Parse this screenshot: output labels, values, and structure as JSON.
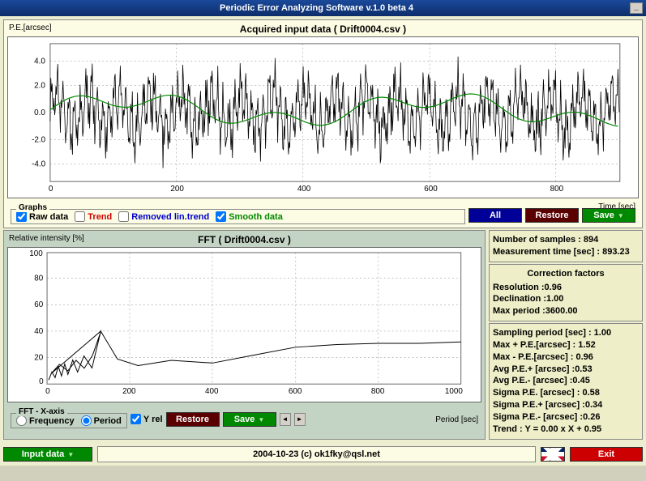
{
  "window": {
    "title": "Periodic Error Analyzing Software v.1.0 beta 4"
  },
  "top_chart": {
    "title": "Acquired input data ( Drift0004.csv )",
    "ylabel": "P.E.[arcsec]",
    "xlabel": "Time [sec]"
  },
  "graphs": {
    "title": "Graphs",
    "raw": "Raw data",
    "trend": "Trend",
    "removed": "Removed lin.trend",
    "smooth": "Smooth data",
    "all": "All",
    "restore": "Restore",
    "save": "Save"
  },
  "fft_chart": {
    "title": "FFT  ( Drift0004.csv )",
    "ylabel": "Relative intensity [%]",
    "xlabel": "Period [sec]"
  },
  "fft_axis": {
    "title": "FFT - X-axis",
    "freq": "Frequency",
    "period": "Period",
    "yrel": "Y rel",
    "restore": "Restore",
    "save": "Save"
  },
  "info1": {
    "samples": "Number of samples : 894",
    "mtime": "Measurement time [sec] : 893.23"
  },
  "info2": {
    "title": "Correction factors",
    "res": "Resolution :0.96",
    "dec": "Declination :1.00",
    "maxp": "Max period :3600.00"
  },
  "info3": {
    "l1": "Sampling period [sec] : 1.00",
    "l2": "Max + P.E.[arcsec] : 1.52",
    "l3": "Max - P.E.[arcsec] : 0.96",
    "l4": "Avg P.E.+ [arcsec] :0.53",
    "l5": "Avg P.E.- [arcsec] :0.45",
    "l6": "Sigma P.E. [arcsec] : 0.58",
    "l7": "Sigma P.E.+ [arcsec] :0.34",
    "l8": "Sigma P.E.- [arcsec] :0.26",
    "l9": "Trend : Y = 0.00 x X + 0.95"
  },
  "bottom": {
    "input": "Input data",
    "status": "2004-10-23 (c) ok1fky@qsl.net",
    "exit": "Exit"
  },
  "chart_data": [
    {
      "type": "line",
      "title": "Acquired input data ( Drift0004.csv )",
      "xlabel": "Time [sec]",
      "ylabel": "P.E.[arcsec]",
      "xlim": [
        0,
        900
      ],
      "ylim": [
        -4.0,
        4.0
      ],
      "xticks": [
        0,
        200,
        400,
        600,
        800
      ],
      "yticks": [
        -4.0,
        -2.0,
        0.0,
        2.0,
        4.0
      ],
      "series": [
        {
          "name": "Raw data",
          "color": "#000000",
          "note": "dense oscillation roughly ±3 arcsec, ~894 points"
        },
        {
          "name": "Smooth data",
          "color": "#008800",
          "note": "smoothed curve between approx -1.5 and 1.5"
        }
      ]
    },
    {
      "type": "line",
      "title": "FFT ( Drift0004.csv )",
      "xlabel": "Period [sec]",
      "ylabel": "Relative intensity [%]",
      "xlim": [
        0,
        1000
      ],
      "ylim": [
        0,
        100
      ],
      "xticks": [
        0,
        200,
        400,
        600,
        800,
        1000
      ],
      "yticks": [
        0,
        20,
        40,
        60,
        80,
        100
      ],
      "series": [
        {
          "name": "FFT",
          "color": "#000000",
          "x": [
            10,
            30,
            50,
            70,
            90,
            110,
            130,
            170,
            220,
            300,
            400,
            500,
            600,
            700,
            800,
            900,
            1000
          ],
          "y": [
            8,
            15,
            10,
            18,
            12,
            22,
            40,
            19,
            14,
            18,
            16,
            22,
            28,
            30,
            31,
            31,
            32
          ]
        }
      ]
    }
  ]
}
